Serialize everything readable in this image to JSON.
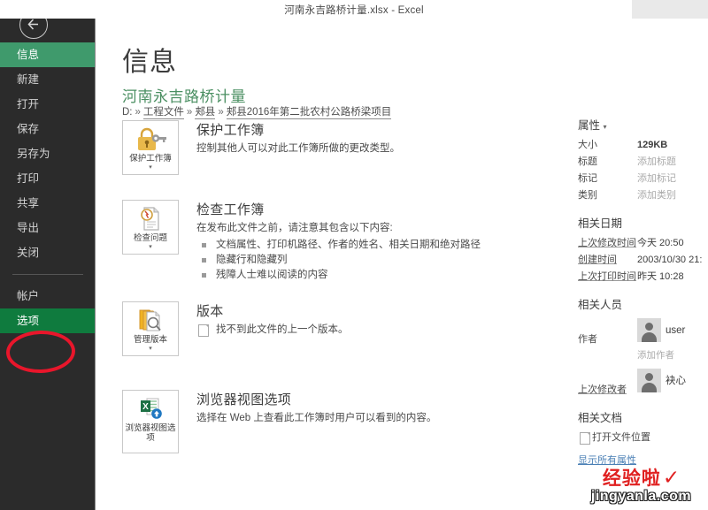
{
  "window": {
    "title": "河南永吉路桥计量.xlsx - Excel"
  },
  "sidebar": {
    "back_icon": "back-arrow-icon",
    "items": [
      {
        "label": "信息",
        "state": "active"
      },
      {
        "label": "新建",
        "state": "normal"
      },
      {
        "label": "打开",
        "state": "normal"
      },
      {
        "label": "保存",
        "state": "normal"
      },
      {
        "label": "另存为",
        "state": "normal"
      },
      {
        "label": "打印",
        "state": "normal"
      },
      {
        "label": "共享",
        "state": "normal"
      },
      {
        "label": "导出",
        "state": "normal"
      },
      {
        "label": "关闭",
        "state": "normal"
      }
    ],
    "items_bottom": [
      {
        "label": "帐户",
        "state": "normal"
      },
      {
        "label": "选项",
        "state": "highlighted"
      }
    ]
  },
  "annotation": {
    "shape": "red-oval",
    "color": "#e8162b",
    "target": "选项"
  },
  "main": {
    "page_title": "信息",
    "document_name": "河南永吉路桥计量",
    "path": {
      "drive": "D:",
      "segments": [
        "工程文件",
        "郏县",
        "郏县2016年第二批农村公路桥梁项目"
      ],
      "separator": "»"
    },
    "sections": [
      {
        "tile_label": "保护工作簿",
        "tile_icon": "lock-key-icon",
        "tile_has_caret": true,
        "heading": "保护工作簿",
        "description": "控制其他人可以对此工作簿所做的更改类型。",
        "bullets": []
      },
      {
        "tile_label": "检查问题",
        "tile_icon": "inspect-document-icon",
        "tile_has_caret": true,
        "heading": "检查工作簿",
        "description": "在发布此文件之前，请注意其包含以下内容:",
        "bullets": [
          "文档属性、打印机路径、作者的姓名、相关日期和绝对路径",
          "隐藏行和隐藏列",
          "残障人士难以阅读的内容"
        ]
      },
      {
        "tile_label": "管理版本",
        "tile_icon": "manage-versions-icon",
        "tile_has_caret": true,
        "heading": "版本",
        "version_note": "找不到此文件的上一个版本。",
        "bullets": []
      },
      {
        "tile_label": "浏览器视图选项",
        "tile_icon": "browser-view-icon",
        "tile_has_caret": false,
        "heading": "浏览器视图选项",
        "description": "选择在 Web 上查看此工作簿时用户可以看到的内容。",
        "bullets": []
      }
    ]
  },
  "properties": {
    "title": "属性",
    "caret": "▾",
    "rows": [
      {
        "key": "大小",
        "value": "129KB",
        "style": "bold"
      },
      {
        "key": "标题",
        "value": "添加标题",
        "style": "placeholder"
      },
      {
        "key": "标记",
        "value": "添加标记",
        "style": "placeholder"
      },
      {
        "key": "类别",
        "value": "添加类别",
        "style": "placeholder"
      }
    ],
    "dates": {
      "title": "相关日期",
      "rows": [
        {
          "key": "上次修改时间",
          "value": "今天 20:50"
        },
        {
          "key": "创建时间",
          "value": "2003/10/30 21:"
        },
        {
          "key": "上次打印时间",
          "value": "昨天 10:28"
        }
      ]
    },
    "people": {
      "title": "相关人员",
      "author_key": "作者",
      "author_name": "user",
      "add_author": "添加作者",
      "modifier_key": "上次修改者",
      "modifier_name": "袂心"
    },
    "documents": {
      "title": "相关文档",
      "open_location": "打开文件位置",
      "show_all": "显示所有属性"
    }
  },
  "watermark": {
    "brand": "经验啦",
    "check": "✓",
    "url": "jingyanla.com"
  }
}
